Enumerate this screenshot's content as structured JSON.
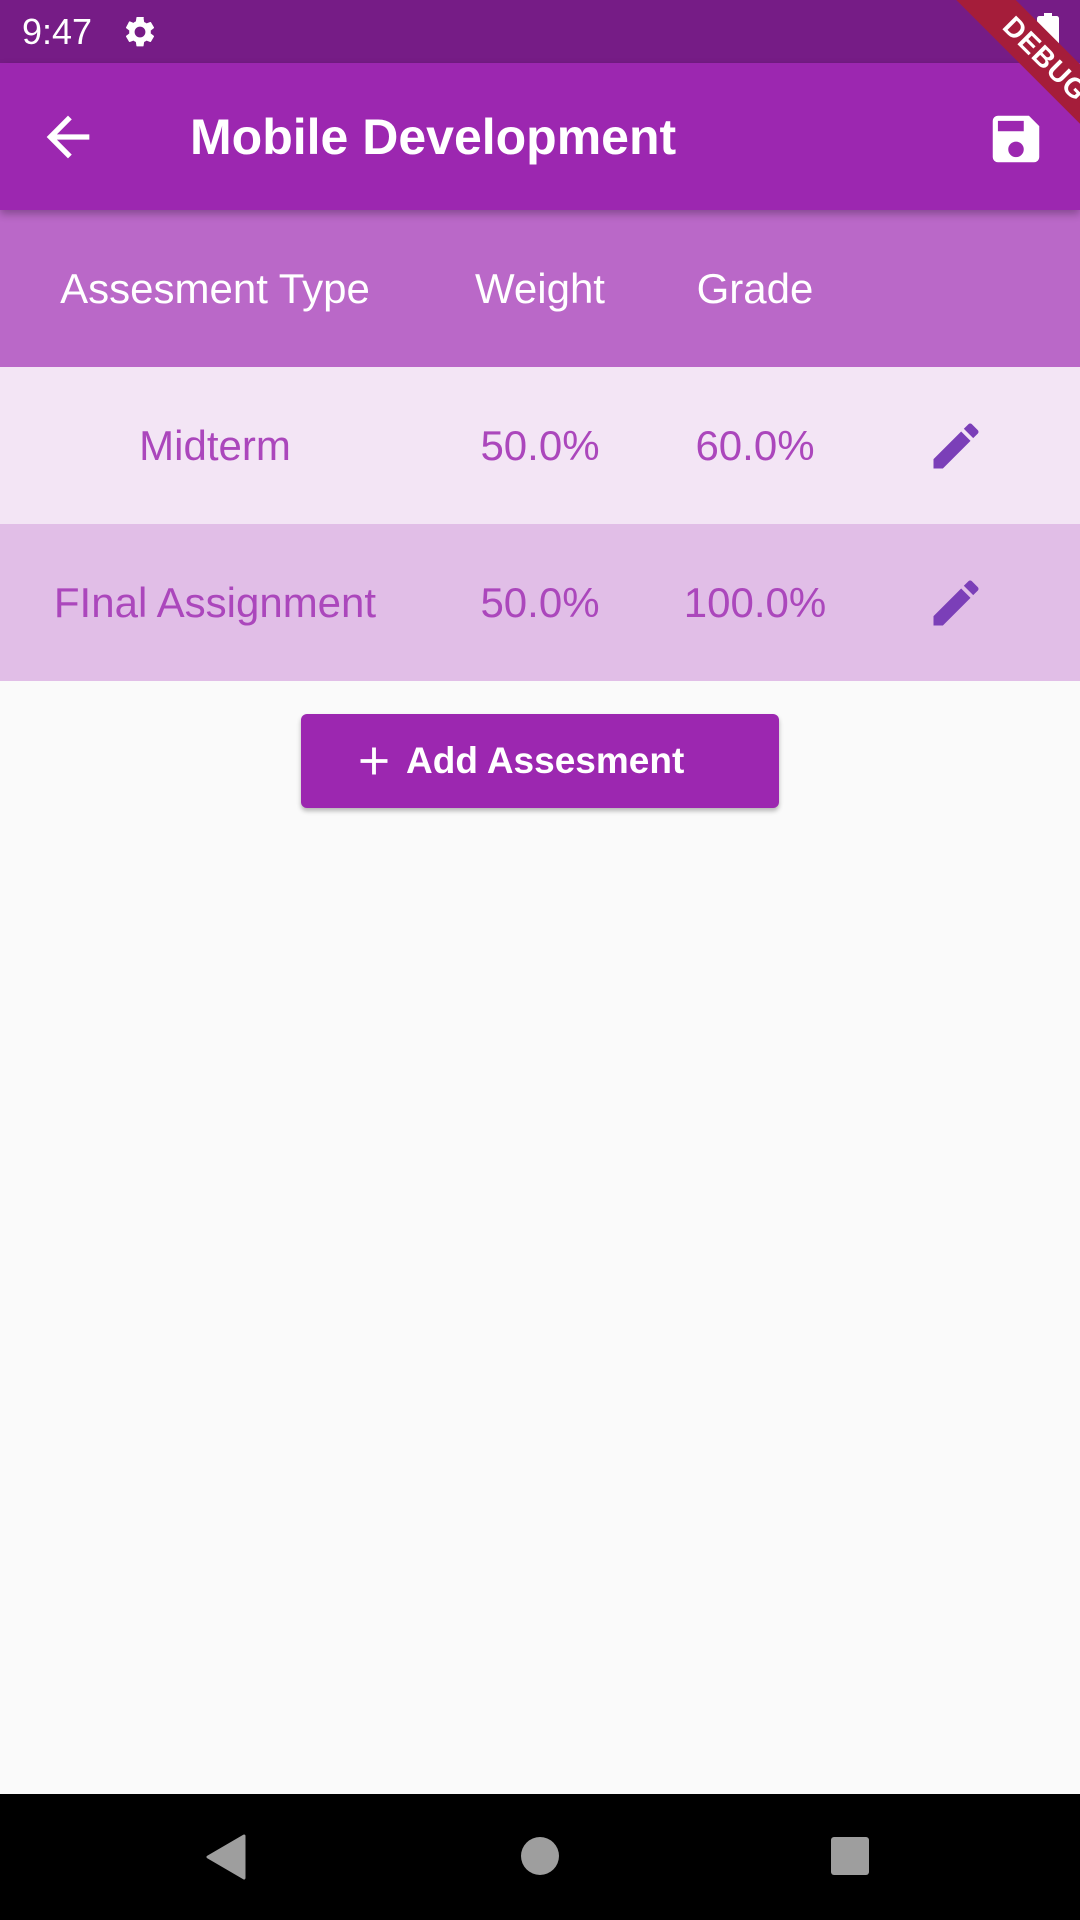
{
  "status_bar": {
    "time": "9:47",
    "icons": [
      "gear-icon",
      "battery-icon"
    ]
  },
  "app_bar": {
    "title": "Mobile Development",
    "back_icon": "arrow-back-icon",
    "save_icon": "save-icon"
  },
  "debug_banner": {
    "label": "DEBUG"
  },
  "table": {
    "headers": [
      "Assesment Type",
      "Weight",
      "Grade"
    ],
    "rows": [
      {
        "type": "Midterm",
        "weight": "50.0%",
        "grade": "60.0%",
        "action_icon": "edit-icon"
      },
      {
        "type": "FInal Assignment",
        "weight": "50.0%",
        "grade": "100.0%",
        "action_icon": "edit-icon"
      }
    ]
  },
  "add_button": {
    "label": "Add Assesment",
    "icon": "plus-icon"
  },
  "nav_bar": {
    "icons": [
      "nav-back-icon",
      "nav-home-icon",
      "nav-recents-icon"
    ]
  },
  "colors": {
    "status_bar": "#761c86",
    "app_bar": "#9c27b0",
    "header_row": "#ba68c8",
    "row_light": "#f3e5f5",
    "row_medium": "#e1bee7",
    "row_text": "#ab47bc",
    "edit_icon": "#7b3fb8",
    "debug_banner": "#a51d3a"
  }
}
